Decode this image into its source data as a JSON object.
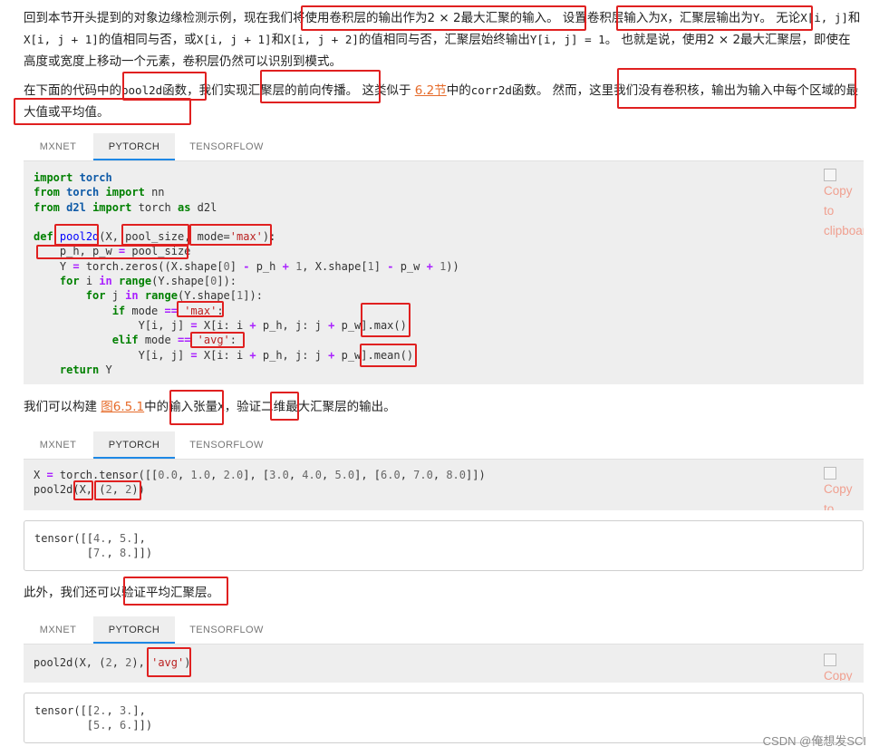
{
  "para1": {
    "t1": "回到本节开头提到的对象边缘检测示例，现在我们将使用卷积层的输出作为2 × 2最大汇聚的输入。 设置卷积层输入为",
    "c1": "X",
    "t2": "，汇聚层输出为",
    "c2": "Y",
    "t3": "。 无论",
    "c3": "X[i, j]",
    "t4": "和",
    "c4": "X[i, j + 1]",
    "t5": "的值相同与否，或",
    "c5": "X[i, j + 1]",
    "t6": "和",
    "c6": "X[i, j + 2]",
    "t7": "的值相同与否，汇聚层始终输出",
    "c7": "Y[i, j] = 1",
    "t8": "。 也就是说，使用2 × 2最大汇聚层，即使在高度或宽度上移动一个元素，卷积层仍然可以识别到模式。"
  },
  "para2": {
    "t1": "在下面的代码中的",
    "c1": "pool2d",
    "t2": "函数，我们实现汇聚层的前向传播。 这类似于 ",
    "link": "6.2节",
    "t3": "中的",
    "c2": "corr2d",
    "t4": "函数。 然而，这里我们没有卷积核，输出为输入中每个区域的最大值或平均值。"
  },
  "para3": {
    "t1": "我们可以构建 ",
    "link": "图6.5.1",
    "t2": "中的输入张量",
    "c1": "X",
    "t3": "，验证二维最大汇聚层的输出。"
  },
  "para4": {
    "text": "此外，我们还可以验证平均汇聚层。"
  },
  "tabs": {
    "mxnet": "MXNET",
    "pytorch": "PYTORCH",
    "tensorflow": "TENSORFLOW"
  },
  "copy": {
    "label": "Copy to clipboard"
  },
  "watermark": "CSDN @俺想发SCI"
}
